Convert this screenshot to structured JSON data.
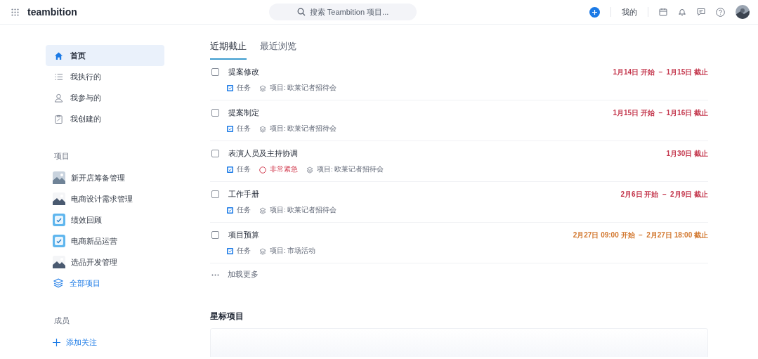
{
  "header": {
    "logo": "teambition",
    "search": {
      "placeholder": "搜索 Teambition 项目..."
    },
    "my_label": "我的"
  },
  "sidebar": {
    "nav": [
      {
        "label": "首页",
        "selected": true
      },
      {
        "label": "我执行的",
        "selected": false
      },
      {
        "label": "我参与的",
        "selected": false
      },
      {
        "label": "我创建的",
        "selected": false
      }
    ],
    "projects_heading": "项目",
    "projects": [
      {
        "label": "新开店筹备管理",
        "kind": "picture"
      },
      {
        "label": "电商设计需求管理",
        "kind": "picture"
      },
      {
        "label": "绩效回顾",
        "kind": "check"
      },
      {
        "label": "电商新品运营",
        "kind": "check"
      },
      {
        "label": "选品开发管理",
        "kind": "picture"
      }
    ],
    "all_projects": "全部项目",
    "members_heading": "成员",
    "add_follow": "添加关注"
  },
  "tabs": [
    {
      "label": "近期截止",
      "selected": true
    },
    {
      "label": "最近浏览",
      "selected": false
    }
  ],
  "tasks": [
    {
      "title": "提案修改",
      "checked": false,
      "date": "1月14日 开始  –  1月15日 截止",
      "color": "#c4374d",
      "meta": [
        {
          "kind": "type",
          "text": "任务"
        },
        {
          "kind": "project",
          "text": "项目: 欧莱记者招待会"
        }
      ]
    },
    {
      "title": "提案制定",
      "checked": false,
      "date": "1月15日 开始  –  1月16日 截止",
      "color": "#c4374d",
      "meta": [
        {
          "kind": "type",
          "text": "任务"
        },
        {
          "kind": "project",
          "text": "项目: 欧莱记者招待会"
        }
      ]
    },
    {
      "title": "表演人员及主持协调",
      "checked": false,
      "date": "1月30日 截止",
      "color": "#c4374d",
      "meta": [
        {
          "kind": "type",
          "text": "任务"
        },
        {
          "kind": "priority",
          "text": "非常紧急"
        },
        {
          "kind": "project",
          "text": "项目: 欧莱记者招待会"
        }
      ]
    },
    {
      "title": "工作手册",
      "checked": false,
      "date": "2月6日 开始  –  2月9日 截止",
      "color": "#c4374d",
      "meta": [
        {
          "kind": "type",
          "text": "任务"
        },
        {
          "kind": "project",
          "text": "项目: 欧莱记者招待会"
        }
      ]
    },
    {
      "title": "项目预算",
      "checked": false,
      "date": "2月27日 09:00 开始  –  2月27日 18:00 截止",
      "color": "#d2772e",
      "meta": [
        {
          "kind": "type",
          "text": "任务"
        },
        {
          "kind": "project",
          "text": "项目: 市场活动"
        }
      ]
    }
  ],
  "load_more": "加载更多",
  "starred_heading": "星标项目"
}
